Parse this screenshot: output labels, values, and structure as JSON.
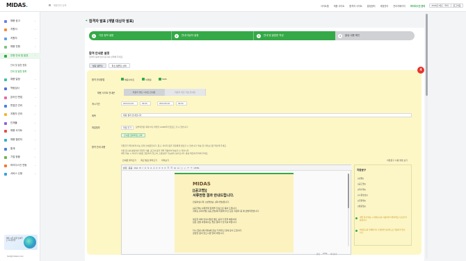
{
  "header": {
    "logo": "MIDAS",
    "search_placeholder": "채용관리 검색",
    "nav": [
      "사이트맵",
      "채용 사이트",
      "합격자 사이트",
      "알림센터",
      "계정관리",
      "관리자페이지"
    ],
    "highlight": "마이다스인 관리",
    "btn1": "2024년 4월",
    "btn2": "마이",
    "btn3": "로그아웃"
  },
  "sidebar": {
    "items": [
      {
        "label": "채용 공고",
        "color": "#6a7cf0"
      },
      {
        "label": "지원서",
        "color": "#f08a3c"
      },
      {
        "label": "지원자",
        "color": "#5aa1f0"
      },
      {
        "label": "채용 전형",
        "color": "#7bc47f"
      },
      {
        "label": "전형 안내 및 발표",
        "color": "#35a947"
      },
      {
        "label": "채용 일정",
        "color": "#3cbfa6"
      },
      {
        "label": "역량검사",
        "color": "#5b6bd8"
      },
      {
        "label": "온라인 면접",
        "color": "#e66a9c"
      },
      {
        "label": "면접관 관리",
        "color": "#3d86e4"
      },
      {
        "label": "지원자 관리",
        "color": "#f4b52d"
      },
      {
        "label": "인재풀",
        "color": "#8f63d8"
      },
      {
        "label": "채용 사이트",
        "color": "#e94b4b"
      },
      {
        "label": "채용 캘린더",
        "color": "#2fb0c7"
      },
      {
        "label": "통계",
        "color": "#4a7bdb"
      },
      {
        "label": "기업 현황",
        "color": "#6fb34a"
      },
      {
        "label": "마이다스인 연동",
        "color": "#ee7b2c"
      },
      {
        "label": "서비스 신청",
        "color": "#3a9ee0"
      }
    ],
    "subs": [
      "안내 및 발표 현황",
      "안내 및 발표 등록"
    ],
    "banner": "채용 시즌 효율 높여주는 AI 솔루션",
    "footer": "help@midasin.com"
  },
  "page": {
    "title": "합격자 발표 (개별 대상자 발표)"
  },
  "steps": [
    "기존 정보 설정",
    "안내 대상자 설정",
    "안내 및 발표문 작성",
    "발송 내용 확인"
  ],
  "section": {
    "title": "합격 안내문 설정",
    "sub": "합격자 등에 안내 문구를 선택해 주세요.",
    "tabs": [
      "발표 템플릿",
      "최신 템플릿 선택"
    ]
  },
  "badge": "4",
  "form": {
    "label_method": "합격 안내방법",
    "chk": [
      "채용사이트",
      "이메일",
      "SMS"
    ],
    "label_sms": "채용 사이트 안내문",
    "grey": [
      "지원자 개인 사이트 안내문",
      "지원자 개인 기본 안내문"
    ],
    "label_date": "게시기간",
    "date": [
      "2024.04.29",
      "09:00",
      "2024.05.29",
      "09:00"
    ],
    "label_subject": "제목",
    "subject": "채용 결과 안내입니다",
    "label_attach": "파일첨부",
    "attach_btn": "파일 추가",
    "attach_note": "첨부파일은 최대 5개, 파일당 10MB까지 업로드 할 수 있습니다.",
    "attach_btn2": "안내문 첨부파일 선택",
    "label_body": "합격 안내 내용",
    "body_note1": "지원자가 확인하게 되는 합격 안내문입니다. 문구, 이미지 등을 자유롭게 편집할 수 있습니다. 발송 전 미리보기로 확인해 주세요.",
    "body_note2": "치환 문구를 활용하면 지원자 이름, 공고명 등을 개별 적용하여 발송할 수 있습니다.",
    "body_note3": "메일 발송 시 이미지 사용은 권장하지 않으며, 스팸 분류 가능성이 높아집니다. 용량 제한에 주의해 주세요.",
    "tools": [
      "안내문 불러오기",
      "최근 발표 불러오기",
      "미리보기"
    ],
    "apply_link": "치환문구 사용 방법 보기"
  },
  "editor": {
    "tools": [
      "본문",
      "돋움",
      "10pt",
      "B",
      "I",
      "U",
      "S",
      "A",
      "A",
      "≡",
      "≡",
      "≡",
      "≡",
      "☰",
      "☰",
      "⊞",
      "⊟",
      "▢",
      "◇",
      "↶",
      "↷",
      "HTML"
    ],
    "logo": "MIDAS",
    "heading": "[(공고명)]\n서류전형 결과 안내드립니다.",
    "p1": "안녕하십니까, [(성명)]님. [(회사명)]입니다.",
    "p2": "[(공고명)] 서류전형 합격을 진심으로 축하 드립니다.\n귀하는 [(회사명)] [(공고명)]에 지원해 주신 모든 지원자 중 에 선발되었습니다.",
    "p3": "필요한 세부 안내사항은 별도 공지가 있을 예정이며\n남은 선발 과정에서도 좋은 결과가 있기를 바랍니다.",
    "p4": "다시 한번 [(회사명)]에 관심 가져주신 것에 감사 드립니다.\n궁금한 점이 있으시면 연락 바랍니다.",
    "status": [
      "편집",
      "HTML",
      "미리보기"
    ],
    "col_title": "치환문구",
    "col_items": [
      "[(성명)]",
      "[(공고명)]",
      "[(회사명)]",
      "[(수험번호)]",
      "[(전형명)]",
      "[(발표일)]"
    ],
    "note1": "개별 합격 발표 시 치환문구를 사용하면 지원자별로 다르게 적용됩니다.",
    "note2": "치환문구를 삭제하거나 수정하면 정상적으로 적용되지 않습니다."
  }
}
